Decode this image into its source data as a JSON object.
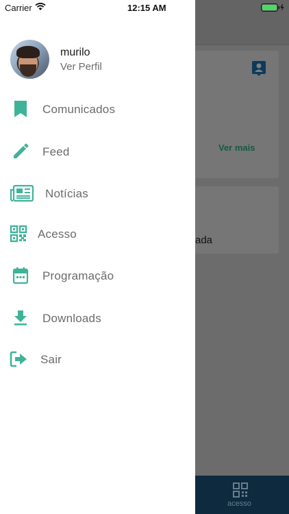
{
  "status_bar": {
    "carrier": "Carrier",
    "time": "12:15 AM"
  },
  "background": {
    "card_link": "Ver mais",
    "card_text": "ada",
    "tab_label": "acesso"
  },
  "profile": {
    "name": "murilo",
    "link": "Ver Perfil"
  },
  "menu": [
    {
      "label": "Comunicados",
      "icon": "bookmark-icon"
    },
    {
      "label": "Feed",
      "icon": "pencil-icon"
    },
    {
      "label": "Notícias",
      "icon": "newspaper-icon"
    },
    {
      "label": "Acesso",
      "icon": "qr-code-icon"
    },
    {
      "label": "Programação",
      "icon": "calendar-icon"
    },
    {
      "label": "Downloads",
      "icon": "download-icon"
    },
    {
      "label": "Sair",
      "icon": "logout-icon"
    }
  ],
  "colors": {
    "accent": "#3fb39a",
    "text": "#6b6b6b",
    "scrim": "#6c6c6c",
    "tabbar": "#0d2a3f"
  }
}
